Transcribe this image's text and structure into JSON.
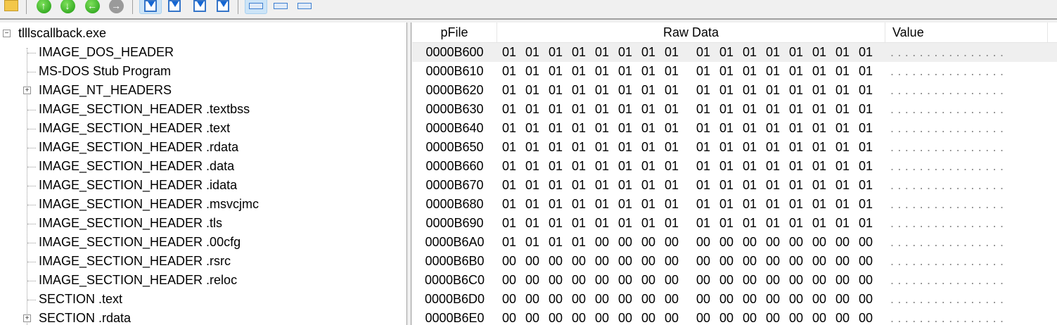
{
  "toolbar": {
    "buttons": [
      "open-icon",
      "up-icon",
      "down-icon",
      "back-icon",
      "forward-icon",
      "view1-icon",
      "view2-icon",
      "view3-icon",
      "view4-icon",
      "layout-wide-icon",
      "layout-medium-icon",
      "layout-narrow-icon"
    ]
  },
  "tree": {
    "root": "tlllscallback.exe",
    "items": [
      {
        "label": "IMAGE_DOS_HEADER",
        "expandable": false
      },
      {
        "label": "MS-DOS Stub Program",
        "expandable": false
      },
      {
        "label": "IMAGE_NT_HEADERS",
        "expandable": true
      },
      {
        "label": "IMAGE_SECTION_HEADER .textbss",
        "expandable": false
      },
      {
        "label": "IMAGE_SECTION_HEADER .text",
        "expandable": false
      },
      {
        "label": "IMAGE_SECTION_HEADER .rdata",
        "expandable": false
      },
      {
        "label": "IMAGE_SECTION_HEADER .data",
        "expandable": false
      },
      {
        "label": "IMAGE_SECTION_HEADER .idata",
        "expandable": false
      },
      {
        "label": "IMAGE_SECTION_HEADER .msvcjmc",
        "expandable": false
      },
      {
        "label": "IMAGE_SECTION_HEADER .tls",
        "expandable": false
      },
      {
        "label": "IMAGE_SECTION_HEADER .00cfg",
        "expandable": false
      },
      {
        "label": "IMAGE_SECTION_HEADER .rsrc",
        "expandable": false
      },
      {
        "label": "IMAGE_SECTION_HEADER .reloc",
        "expandable": false
      },
      {
        "label": "SECTION .text",
        "expandable": false
      },
      {
        "label": "SECTION .rdata",
        "expandable": true
      }
    ]
  },
  "table": {
    "columns": [
      "pFile",
      "Raw Data",
      "Value"
    ],
    "rows": [
      {
        "pfile": "0000B600",
        "bytes": "01 01 01 01 01 01 01 01 01 01 01 01 01 01 01 01",
        "value": "................"
      },
      {
        "pfile": "0000B610",
        "bytes": "01 01 01 01 01 01 01 01 01 01 01 01 01 01 01 01",
        "value": "................"
      },
      {
        "pfile": "0000B620",
        "bytes": "01 01 01 01 01 01 01 01 01 01 01 01 01 01 01 01",
        "value": "................"
      },
      {
        "pfile": "0000B630",
        "bytes": "01 01 01 01 01 01 01 01 01 01 01 01 01 01 01 01",
        "value": "................"
      },
      {
        "pfile": "0000B640",
        "bytes": "01 01 01 01 01 01 01 01 01 01 01 01 01 01 01 01",
        "value": "................"
      },
      {
        "pfile": "0000B650",
        "bytes": "01 01 01 01 01 01 01 01 01 01 01 01 01 01 01 01",
        "value": "................"
      },
      {
        "pfile": "0000B660",
        "bytes": "01 01 01 01 01 01 01 01 01 01 01 01 01 01 01 01",
        "value": "................"
      },
      {
        "pfile": "0000B670",
        "bytes": "01 01 01 01 01 01 01 01 01 01 01 01 01 01 01 01",
        "value": "................"
      },
      {
        "pfile": "0000B680",
        "bytes": "01 01 01 01 01 01 01 01 01 01 01 01 01 01 01 01",
        "value": "................"
      },
      {
        "pfile": "0000B690",
        "bytes": "01 01 01 01 01 01 01 01 01 01 01 01 01 01 01 01",
        "value": "................"
      },
      {
        "pfile": "0000B6A0",
        "bytes": "01 01 01 01 00 00 00 00 00 00 00 00 00 00 00 00",
        "value": "................"
      },
      {
        "pfile": "0000B6B0",
        "bytes": "00 00 00 00 00 00 00 00 00 00 00 00 00 00 00 00",
        "value": "................"
      },
      {
        "pfile": "0000B6C0",
        "bytes": "00 00 00 00 00 00 00 00 00 00 00 00 00 00 00 00",
        "value": "................"
      },
      {
        "pfile": "0000B6D0",
        "bytes": "00 00 00 00 00 00 00 00 00 00 00 00 00 00 00 00",
        "value": "................"
      },
      {
        "pfile": "0000B6E0",
        "bytes": "00 00 00 00 00 00 00 00 00 00 00 00 00 00 00 00",
        "value": "................"
      }
    ]
  }
}
